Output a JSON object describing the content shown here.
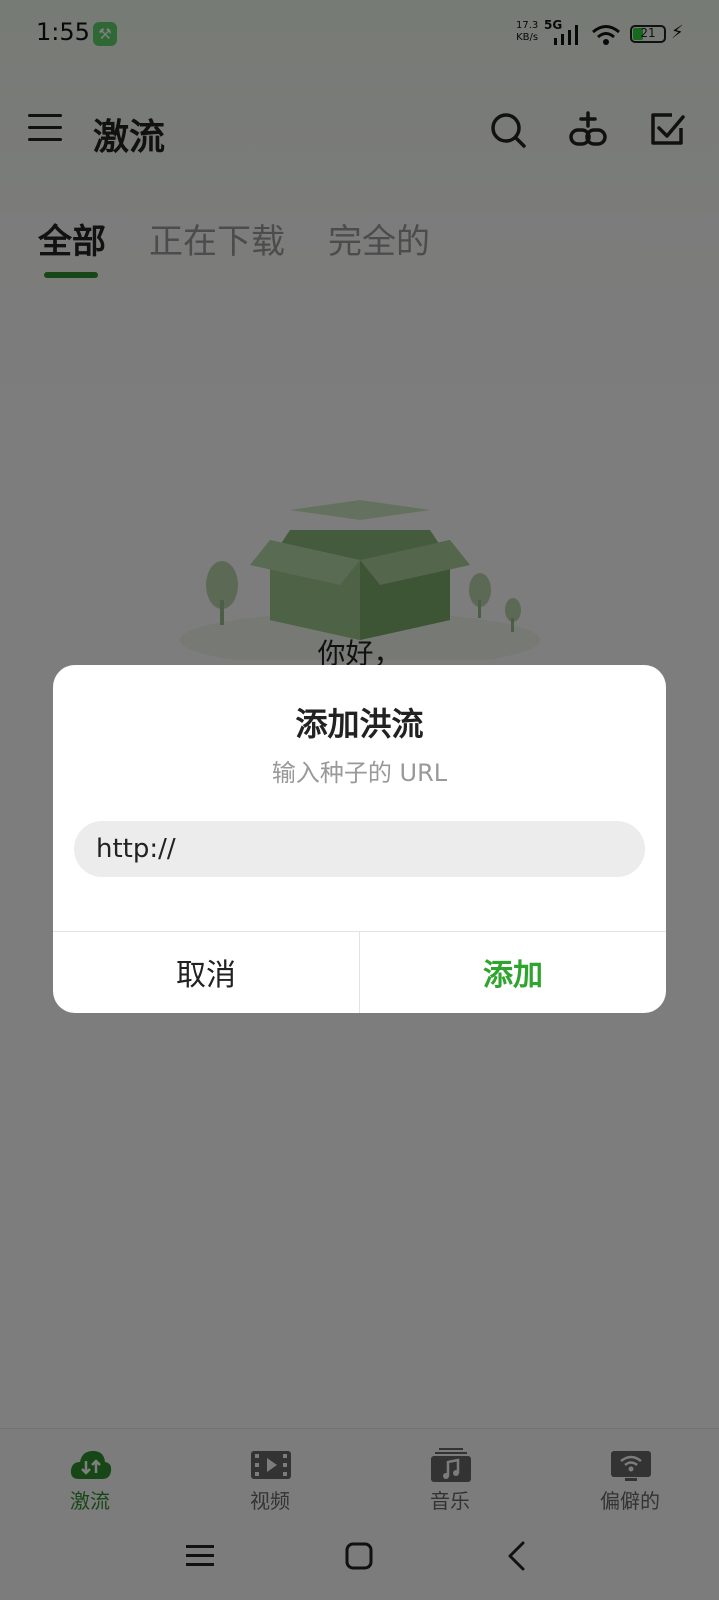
{
  "status_bar": {
    "time": "1:55",
    "net_speed_value": "17.3",
    "net_speed_unit": "KB/s",
    "network_type": "5G",
    "battery_level": "21"
  },
  "app_bar": {
    "title": "激流",
    "icons": [
      "menu-icon",
      "search-icon",
      "add-link-icon",
      "select-all-icon"
    ]
  },
  "tabs": [
    {
      "label": "全部",
      "active": true
    },
    {
      "label": "正在下载",
      "active": false
    },
    {
      "label": "完全的",
      "active": false
    }
  ],
  "empty_state": {
    "text": "你好，"
  },
  "dialog": {
    "title": "添加洪流",
    "subtitle": "输入种子的 URL",
    "input_value": "http://",
    "cancel_label": "取消",
    "confirm_label": "添加"
  },
  "bottom_nav": [
    {
      "label": "激流",
      "icon": "cloud-transfer-icon",
      "active": true
    },
    {
      "label": "视频",
      "icon": "film-icon",
      "active": false
    },
    {
      "label": "音乐",
      "icon": "music-icon",
      "active": false
    },
    {
      "label": "偏僻的",
      "icon": "remote-icon",
      "active": false
    }
  ],
  "colors": {
    "accent": "#2fa52f",
    "scrim": "rgba(0,0,0,0.5)"
  }
}
